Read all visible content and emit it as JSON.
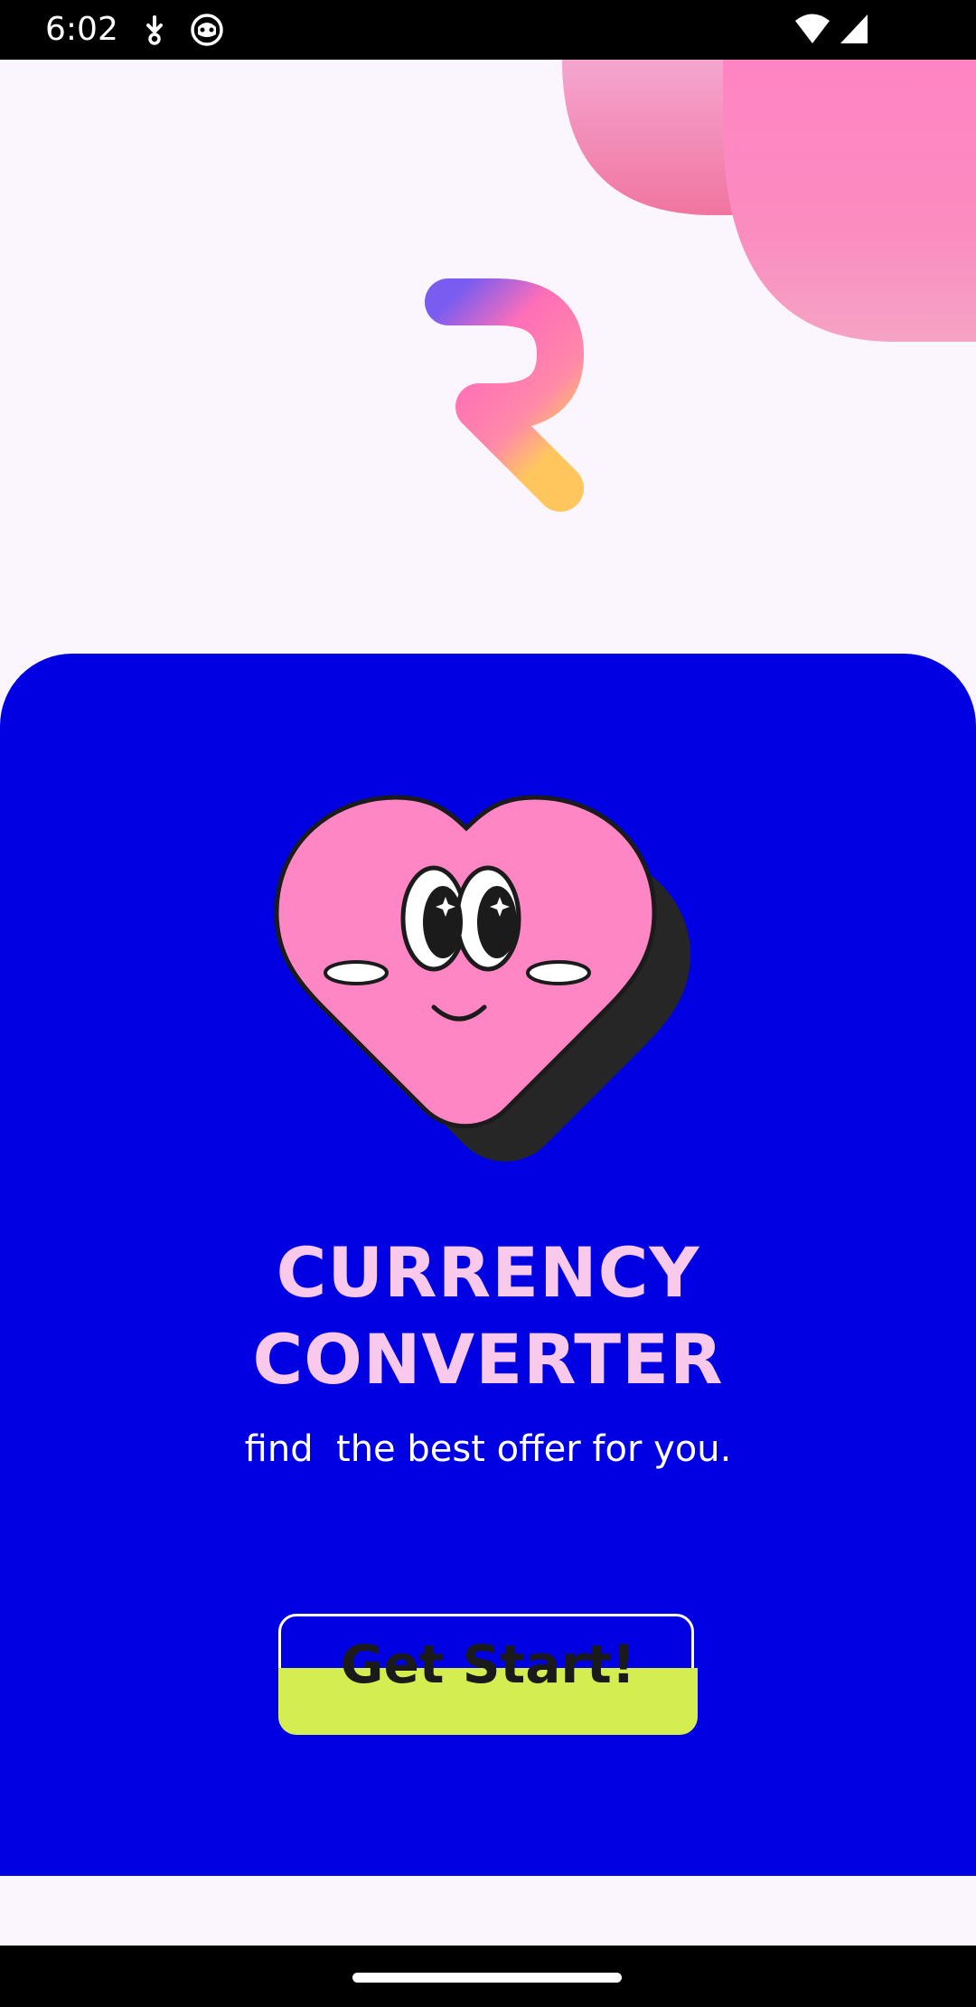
{
  "status_bar": {
    "time": "6:02",
    "icons": [
      "download-icon",
      "cat-face-icon",
      "wifi-icon",
      "signal-icon"
    ]
  },
  "logo": {
    "letter": "R"
  },
  "hero": {
    "title_line1": "CURRENCY",
    "title_line2": "CONVERTER",
    "subtitle": "find  the best offer for you.",
    "mascot": "heart-mascot-icon"
  },
  "cta": {
    "label": "Get Start!"
  },
  "colors": {
    "card_bg": "#0000e3",
    "title": "#f9c9ec",
    "button": "#d4ee52",
    "heart": "#ff86c4",
    "page_bg": "#fbf6fd"
  }
}
